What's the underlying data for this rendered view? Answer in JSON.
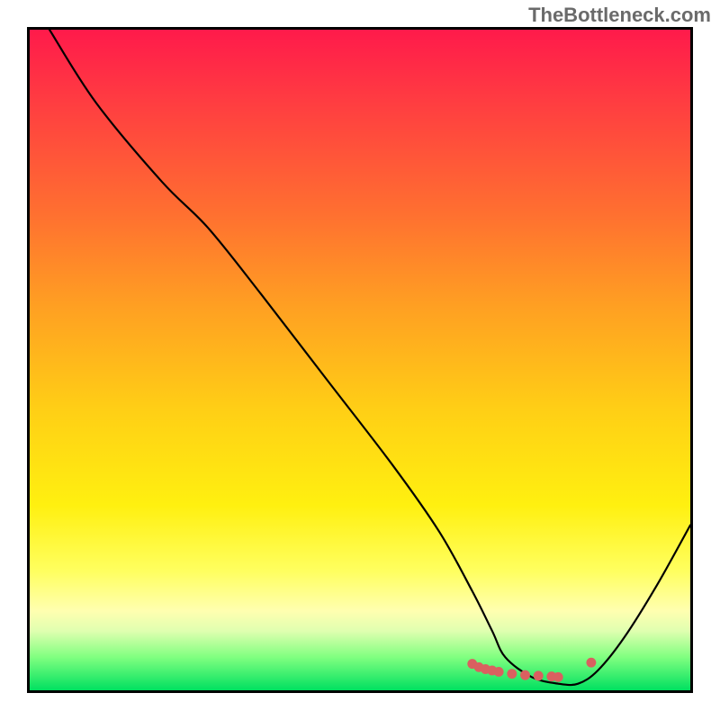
{
  "watermark": "TheBottleneck.com",
  "chart_data": {
    "type": "line",
    "title": "",
    "xlabel": "",
    "ylabel": "",
    "xlim": [
      0,
      100
    ],
    "ylim": [
      0,
      100
    ],
    "series": [
      {
        "name": "bottleneck-curve",
        "color": "#000000",
        "x": [
          3,
          10,
          20,
          27,
          35,
          45,
          55,
          62,
          67,
          70,
          72,
          76,
          80,
          83,
          86,
          90,
          95,
          100
        ],
        "y": [
          100,
          89,
          77,
          70,
          60,
          47,
          34,
          24,
          15,
          9,
          5,
          2,
          1,
          1,
          3,
          8,
          16,
          25
        ]
      },
      {
        "name": "highlight-dots",
        "color": "#d96060",
        "style": "markers",
        "x": [
          67,
          68,
          69,
          70,
          71,
          73,
          75,
          77,
          79,
          80,
          85
        ],
        "y": [
          4,
          3.5,
          3.2,
          3,
          2.8,
          2.5,
          2.3,
          2.2,
          2.1,
          2,
          4.2
        ]
      }
    ]
  }
}
